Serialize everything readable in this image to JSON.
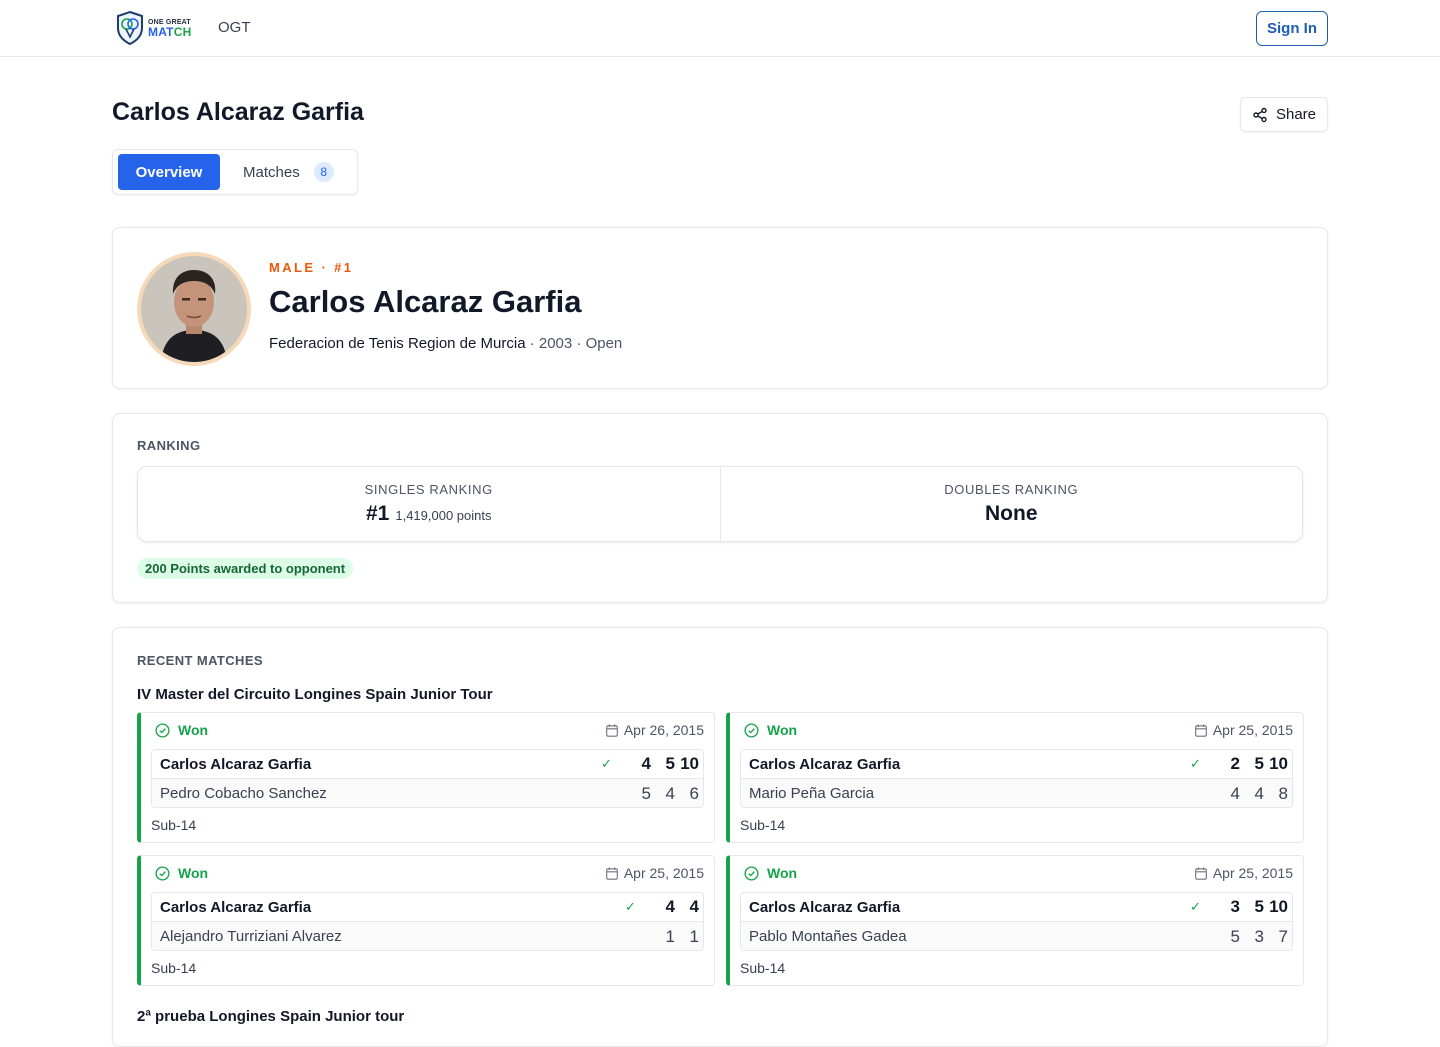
{
  "brand": {
    "logo_line1": "ONE GREAT",
    "logo_line2a": "MAT",
    "logo_line2b": "CH",
    "name": "OGT",
    "colors": {
      "primary": "#2563eb",
      "accent": "#16a34a",
      "highlight": "#ea580c"
    }
  },
  "header": {
    "sign_in": "Sign In",
    "title": "Carlos Alcaraz Garfia",
    "share": "Share",
    "share_icon": "share-icon"
  },
  "tabs": [
    {
      "label": "Overview",
      "active": true
    },
    {
      "label": "Matches",
      "badge": "8",
      "active": false
    }
  ],
  "profile": {
    "meta": "MALE · #1",
    "name": "Carlos Alcaraz Garfia",
    "federation": "Federacion de Tenis Region de Murcia",
    "details": " · 2003 · Open"
  },
  "ranking": {
    "section": "RANKING",
    "singles_title": "SINGLES RANKING",
    "singles_value": "#1",
    "singles_points": "1,419,000 points",
    "doubles_title": "DOUBLES RANKING",
    "doubles_value": "None",
    "pill": "200 Points awarded to opponent"
  },
  "recent": {
    "section": "RECENT MATCHES",
    "tournament1": "IV Master del Circuito Longines Spain Junior Tour",
    "tournament2": "2ª prueba Longines Spain Junior tour",
    "matches": [
      {
        "status": "Won",
        "date": "Apr 26, 2015",
        "winner": "Carlos Alcaraz Garfia",
        "winner_scores": [
          "4",
          "5",
          "10"
        ],
        "loser": "Pedro Cobacho Sanchez",
        "loser_scores": [
          "5",
          "4",
          "6"
        ],
        "category": "Sub-14"
      },
      {
        "status": "Won",
        "date": "Apr 25, 2015",
        "winner": "Carlos Alcaraz Garfia",
        "winner_scores": [
          "2",
          "5",
          "10"
        ],
        "loser": "Mario Peña Garcia",
        "loser_scores": [
          "4",
          "4",
          "8"
        ],
        "category": "Sub-14"
      },
      {
        "status": "Won",
        "date": "Apr 25, 2015",
        "winner": "Carlos Alcaraz Garfia",
        "winner_scores": [
          "4",
          "4"
        ],
        "loser": "Alejandro Turriziani Alvarez",
        "loser_scores": [
          "1",
          "1"
        ],
        "category": "Sub-14"
      },
      {
        "status": "Won",
        "date": "Apr 25, 2015",
        "winner": "Carlos Alcaraz Garfia",
        "winner_scores": [
          "3",
          "5",
          "10"
        ],
        "loser": "Pablo Montañes Gadea",
        "loser_scores": [
          "5",
          "3",
          "7"
        ],
        "category": "Sub-14"
      }
    ]
  }
}
